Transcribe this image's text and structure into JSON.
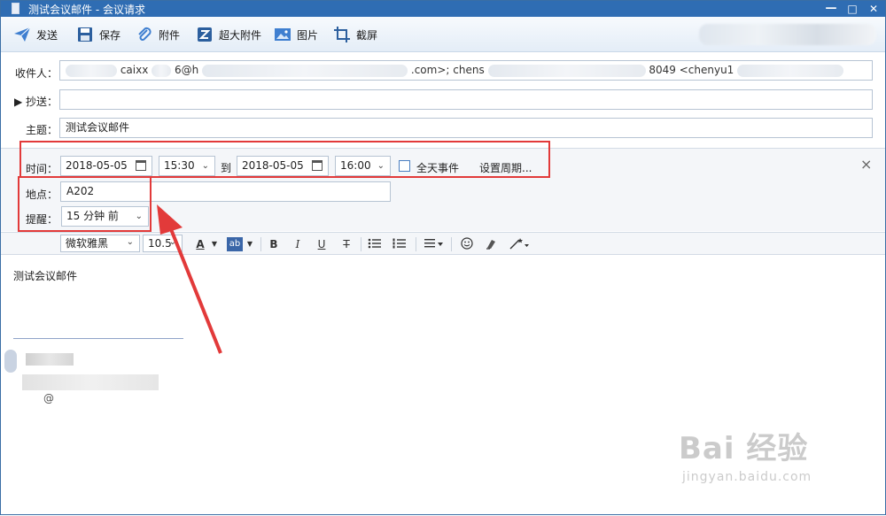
{
  "window": {
    "title": "测试会议邮件 - 会议请求",
    "minimize": "—",
    "maximize": "□",
    "close": "✕"
  },
  "toolbar": {
    "send": "发送",
    "save": "保存",
    "attach": "附件",
    "big_attach": "超大附件",
    "image": "图片",
    "screenshot": "截屏"
  },
  "header": {
    "to_label": "收件人：",
    "to_parts": [
      "caixx",
      "6@h",
      ".com>;",
      "chens",
      "8049 <chenyu1"
    ],
    "cc_label": "▶ 抄送：",
    "cc_value": "",
    "subject_label": "主题：",
    "subject_value": "测试会议邮件"
  },
  "meeting": {
    "time_label": "时间：",
    "start_date": "2018-05-05",
    "start_time": "15:30",
    "to_word": "到",
    "end_date": "2018-05-05",
    "end_time": "16:00",
    "all_day": "全天事件",
    "recurrence": "设置周期...",
    "location_label": "地点：",
    "location_value": "A202",
    "reminder_label": "提醒：",
    "reminder_value": "15 分钟 前",
    "close": "×"
  },
  "format": {
    "font": "微软雅黑",
    "size": "10.5",
    "bold": "B",
    "italic": "I",
    "underline": "U",
    "strike": "T",
    "font_color": "A",
    "highlight": "ab"
  },
  "body": {
    "text": "测试会议邮件",
    "sig_char": "@"
  },
  "watermark": {
    "logo": "Bai 经验",
    "url": "jingyan.baidu.com"
  },
  "colors": {
    "accent": "#2f6db3",
    "annotation": "#e23a3a"
  }
}
